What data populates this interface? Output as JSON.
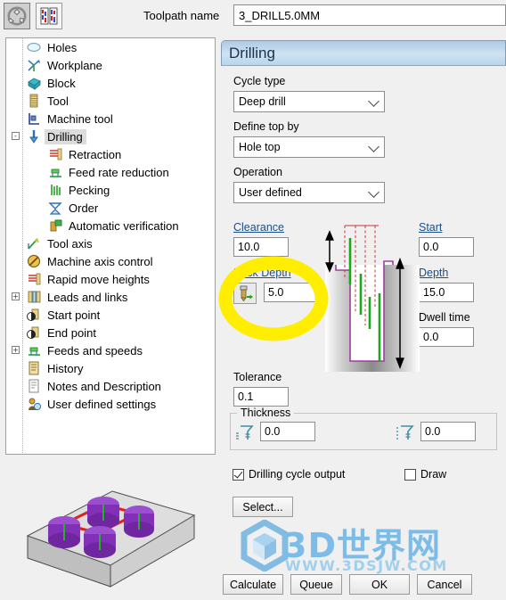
{
  "toolbar": {
    "buttons": [
      {
        "name": "recycle-icon",
        "title": "Toolpath recycle"
      },
      {
        "name": "toolpath-preview-icon",
        "title": "Toolpath preview"
      }
    ]
  },
  "toolpath": {
    "label": "Toolpath name",
    "value": "3_DRILL5.0MM",
    "placeholder": ""
  },
  "tree": {
    "items": [
      {
        "label": "Holes",
        "icon": "hole-icon",
        "indent": 0,
        "expander": "",
        "selected": false
      },
      {
        "label": "Workplane",
        "icon": "workplane-icon",
        "indent": 0,
        "expander": "",
        "selected": false
      },
      {
        "label": "Block",
        "icon": "block-icon",
        "indent": 0,
        "expander": "",
        "selected": false
      },
      {
        "label": "Tool",
        "icon": "tool-icon",
        "indent": 0,
        "expander": "",
        "selected": false
      },
      {
        "label": "Machine tool",
        "icon": "machine-tool-icon",
        "indent": 0,
        "expander": "",
        "selected": false
      },
      {
        "label": "Drilling",
        "icon": "drilling-icon",
        "indent": 0,
        "expander": "-",
        "selected": true
      },
      {
        "label": "Retraction",
        "icon": "retraction-icon",
        "indent": 1,
        "expander": "",
        "selected": false
      },
      {
        "label": "Feed rate reduction",
        "icon": "feed-rate-icon",
        "indent": 1,
        "expander": "",
        "selected": false
      },
      {
        "label": "Pecking",
        "icon": "pecking-icon",
        "indent": 1,
        "expander": "",
        "selected": false
      },
      {
        "label": "Order",
        "icon": "order-icon",
        "indent": 1,
        "expander": "",
        "selected": false
      },
      {
        "label": "Automatic verification",
        "icon": "verification-icon",
        "indent": 1,
        "expander": "",
        "selected": false
      },
      {
        "label": "Tool axis",
        "icon": "tool-axis-icon",
        "indent": 0,
        "expander": "",
        "selected": false
      },
      {
        "label": "Machine axis control",
        "icon": "machine-axis-icon",
        "indent": 0,
        "expander": "",
        "selected": false
      },
      {
        "label": "Rapid move heights",
        "icon": "rapid-move-icon",
        "indent": 0,
        "expander": "",
        "selected": false
      },
      {
        "label": "Leads and links",
        "icon": "leads-links-icon",
        "indent": 0,
        "expander": "+",
        "selected": false
      },
      {
        "label": "Start point",
        "icon": "start-point-icon",
        "indent": 0,
        "expander": "",
        "selected": false
      },
      {
        "label": "End point",
        "icon": "end-point-icon",
        "indent": 0,
        "expander": "",
        "selected": false
      },
      {
        "label": "Feeds and speeds",
        "icon": "feeds-speeds-icon",
        "indent": 0,
        "expander": "+",
        "selected": false
      },
      {
        "label": "History",
        "icon": "history-icon",
        "indent": 0,
        "expander": "",
        "selected": false
      },
      {
        "label": "Notes and Description",
        "icon": "notes-icon",
        "indent": 0,
        "expander": "",
        "selected": false
      },
      {
        "label": "User defined settings",
        "icon": "user-settings-icon",
        "indent": 0,
        "expander": "",
        "selected": false
      }
    ]
  },
  "panel": {
    "title": "Drilling",
    "cycle_type": {
      "label": "Cycle type",
      "value": "Deep drill"
    },
    "define_top_by": {
      "label": "Define top by",
      "value": "Hole top"
    },
    "operation": {
      "label": "Operation",
      "value": "User defined"
    },
    "clearance": {
      "label": "Clearance",
      "value": "10.0"
    },
    "peck_depth": {
      "label": "Peck Depth",
      "value": "5.0",
      "icon": "peck-drill-icon"
    },
    "tolerance": {
      "label": "Tolerance",
      "value": "0.1"
    },
    "start": {
      "label": "Start",
      "value": "0.0"
    },
    "depth": {
      "label": "Depth",
      "value": "15.0"
    },
    "dwell_time": {
      "label": "Dwell time",
      "value": "0.0"
    },
    "thickness": {
      "caption": "Thickness",
      "radial": {
        "value": "0.0",
        "icon": "radial-thickness-icon"
      },
      "axial": {
        "value": "0.0",
        "icon": "axial-thickness-icon"
      }
    },
    "drilling_cycle_output": {
      "label": "Drilling cycle output",
      "checked": true
    },
    "draw": {
      "label": "Draw",
      "checked": false
    },
    "select_button": "Select..."
  },
  "buttons": {
    "calculate": "Calculate",
    "queue": "Queue",
    "ok": "OK",
    "cancel": "Cancel"
  },
  "watermark": {
    "text": "3D世界网",
    "url": "WWW.3DSJW.COM"
  },
  "annotation": {
    "type": "yellow-marker-circle",
    "target": "Peck Depth",
    "color": "#ffee00"
  },
  "colors": {
    "panel_header": "#aecae4",
    "link": "#1a4f8a",
    "window_bg": "#f0f0f0",
    "highlight": "#ffee00",
    "toolpath_green": "#00a000",
    "rapid_red": "#cc3333",
    "material_purple": "#9b3f9b"
  }
}
